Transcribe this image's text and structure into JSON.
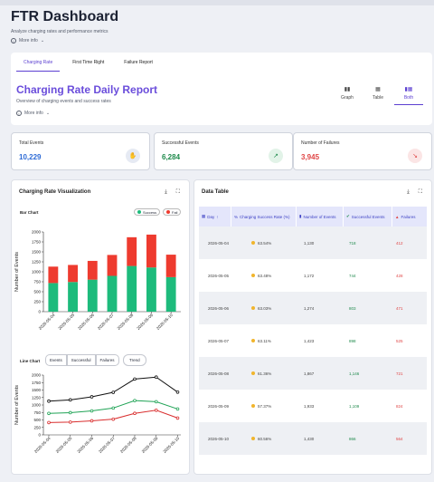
{
  "header": {
    "title": "FTR Dashboard",
    "subtitle": "Analyze charging rates and performance metrics",
    "more_info": "More info"
  },
  "tabs": [
    {
      "label": "Charging Rate",
      "active": true
    },
    {
      "label": "First Time Right",
      "active": false
    },
    {
      "label": "Failure Report",
      "active": false
    }
  ],
  "report": {
    "title": "Charging Rate Daily Report",
    "subtitle": "Overview of charging events and success rates",
    "more_info": "More info"
  },
  "view_toggle": [
    {
      "label": "Graph",
      "icon": "bar-chart-icon",
      "active": false
    },
    {
      "label": "Table",
      "icon": "table-icon",
      "active": false
    },
    {
      "label": "Both",
      "icon": "both-icon",
      "active": true
    }
  ],
  "metrics": [
    {
      "label": "Total Events",
      "value": "10,229",
      "color": "#2e6bd6",
      "icon": "hand-icon",
      "icon_bg": "#e6eaf3"
    },
    {
      "label": "Successful Events",
      "value": "6,284",
      "color": "#1f8a4c",
      "icon": "trend-up-icon",
      "icon_bg": "#e2f3e8"
    },
    {
      "label": "Number of Failures",
      "value": "3,945",
      "color": "#e04646",
      "icon": "trend-down-icon",
      "icon_bg": "#fbe5e5"
    }
  ],
  "viz_card": {
    "title": "Charging Rate Visualization",
    "bar_chart_label": "Bar Chart",
    "legend": [
      {
        "label": "Success",
        "color": "#1dbb7c"
      },
      {
        "label": "Fail",
        "color": "#ee3b2f"
      }
    ],
    "line_chart_label": "Line Chart",
    "line_buttons": [
      "Events",
      "Successful",
      "Failures"
    ],
    "trend_button": "Trend"
  },
  "table_card": {
    "title": "Data Table",
    "columns": [
      "Day",
      "Charging Success Rate (%)",
      "Number of Events",
      "Successful Events",
      "Failures"
    ],
    "rows": [
      {
        "day": "2026-05-04",
        "rate": "63.54%",
        "events": "1,130",
        "success": "718",
        "fail": "412"
      },
      {
        "day": "2026-05-05",
        "rate": "63.48%",
        "events": "1,172",
        "success": "744",
        "fail": "428"
      },
      {
        "day": "2026-05-06",
        "rate": "63.03%",
        "events": "1,274",
        "success": "803",
        "fail": "471"
      },
      {
        "day": "2026-05-07",
        "rate": "63.11%",
        "events": "1,423",
        "success": "898",
        "fail": "525"
      },
      {
        "day": "2026-05-08",
        "rate": "61.36%",
        "events": "1,867",
        "success": "1,146",
        "fail": "721"
      },
      {
        "day": "2026-05-09",
        "rate": "57.37%",
        "events": "1,933",
        "success": "1,109",
        "fail": "824"
      },
      {
        "day": "2026-05-10",
        "rate": "60.56%",
        "events": "1,430",
        "success": "866",
        "fail": "564"
      }
    ]
  },
  "chart_data": [
    {
      "type": "bar",
      "stacked": true,
      "ylabel": "Number of Events",
      "ylim": [
        0,
        2000
      ],
      "yticks": [
        "0",
        "250",
        "500",
        "750",
        "1000",
        "1250",
        "1500",
        "1750",
        "2000"
      ],
      "categories": [
        "2026-05-04",
        "2026-05-05",
        "2026-05-06",
        "2026-05-07",
        "2026-05-08",
        "2026-05-09",
        "2026-05-10"
      ],
      "series": [
        {
          "name": "Success",
          "color": "#1dbb7c",
          "values": [
            718,
            744,
            803,
            898,
            1146,
            1109,
            866
          ]
        },
        {
          "name": "Fail",
          "color": "#ee3b2f",
          "values": [
            412,
            428,
            471,
            525,
            721,
            824,
            564
          ]
        }
      ]
    },
    {
      "type": "line",
      "ylabel": "Number of Events",
      "ylim": [
        0,
        2000
      ],
      "yticks": [
        "0",
        "250",
        "500",
        "750",
        "1000",
        "1250",
        "1500",
        "1750",
        "2000"
      ],
      "categories": [
        "2026-05-04",
        "2026-05-05",
        "2026-05-06",
        "2026-05-07",
        "2026-05-08",
        "2026-05-09",
        "2026-05-10"
      ],
      "series": [
        {
          "color": "#111111",
          "values": [
            1130,
            1172,
            1274,
            1423,
            1867,
            1933,
            1430
          ]
        },
        {
          "color": "#1fa355",
          "values": [
            718,
            744,
            803,
            898,
            1146,
            1109,
            866
          ]
        },
        {
          "color": "#d92e2e",
          "values": [
            412,
            428,
            471,
            525,
            721,
            824,
            564
          ]
        }
      ]
    }
  ]
}
